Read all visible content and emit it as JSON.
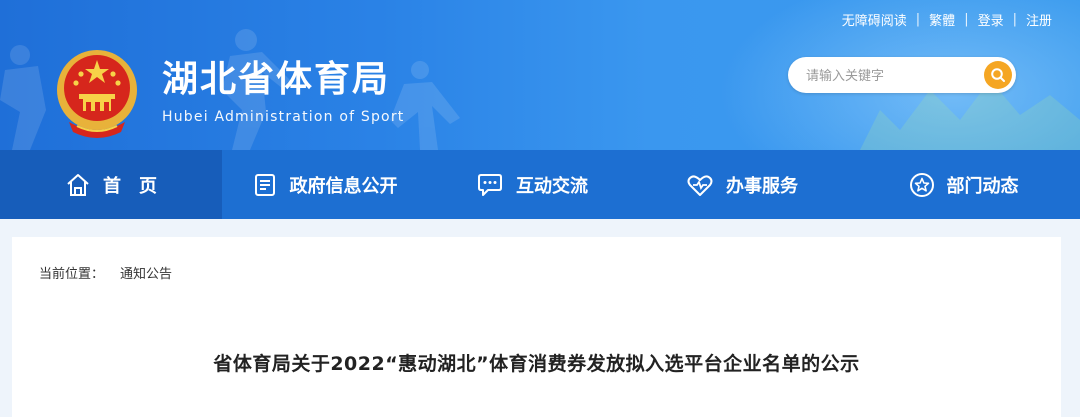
{
  "topbar": {
    "links": [
      "无障碍阅读",
      "繁體",
      "登录",
      "注册"
    ]
  },
  "header": {
    "title_cn": "湖北省体育局",
    "title_en": "Hubei Administration of Sport",
    "emblem_icon": "national-emblem-icon"
  },
  "search": {
    "placeholder": "请输入关键字",
    "icon": "search-icon"
  },
  "nav": {
    "items": [
      {
        "label": "首页",
        "icon": "home-icon",
        "active": true
      },
      {
        "label": "政府信息公开",
        "icon": "document-icon",
        "active": false
      },
      {
        "label": "互动交流",
        "icon": "chat-icon",
        "active": false
      },
      {
        "label": "办事服务",
        "icon": "heart-service-icon",
        "active": false
      },
      {
        "label": "部门动态",
        "icon": "star-circle-icon",
        "active": false
      }
    ]
  },
  "breadcrumb": {
    "label": "当前位置：",
    "current": "通知公告"
  },
  "article": {
    "title": "省体育局关于2022“惠动湖北”体育消费券发放拟入选平台企业名单的公示"
  },
  "colors": {
    "banner": "#2a82e6",
    "nav": "#1d6fd2",
    "nav_active": "#175dba",
    "search_button": "#f5a623"
  }
}
